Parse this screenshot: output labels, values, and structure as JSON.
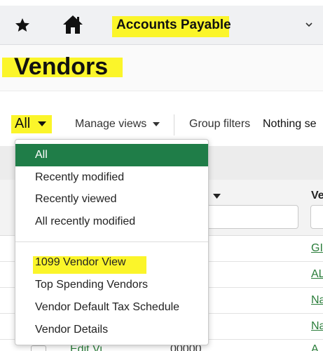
{
  "header": {
    "breadcrumb": "Accounts Payable",
    "icons": [
      "star-icon",
      "home-icon",
      "chevron-down-icon"
    ]
  },
  "page": {
    "title": "Vendors"
  },
  "toolbar": {
    "view_selector": "All",
    "manage_views": "Manage views",
    "group_filters": "Group filters",
    "group_filters_value": "Nothing se"
  },
  "table": {
    "second_column_label": "Ve",
    "row_links": [
      "GI",
      "AL",
      "Na",
      "Na",
      "A"
    ],
    "bottom_row_text": "Edit Vi",
    "bottom_row_num": "00000"
  },
  "view_menu": {
    "selected": "All",
    "group1": [
      "All",
      "Recently modified",
      "Recently viewed",
      "All recently modified"
    ],
    "group2": [
      "1099 Vendor View",
      "Top Spending Vendors",
      "Vendor Default Tax Schedule",
      "Vendor Details"
    ]
  },
  "colors": {
    "highlight": "#fbf52a",
    "selected_menu_bg": "#1f7d48",
    "link_green": "#2a7d3a"
  }
}
